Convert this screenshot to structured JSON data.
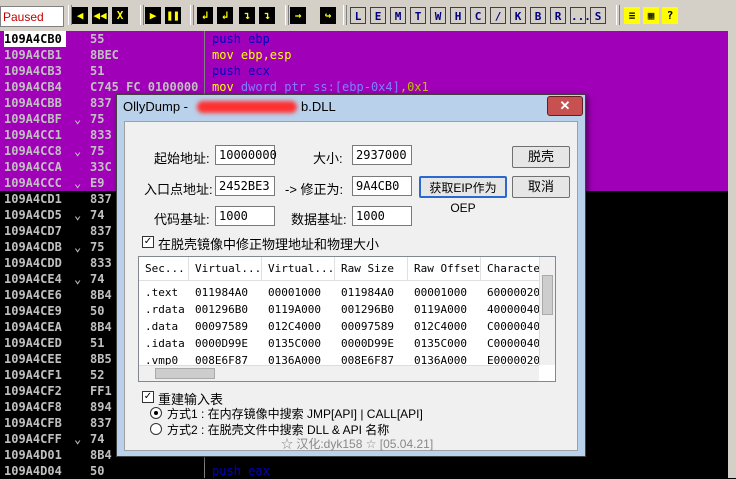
{
  "toolbar": {
    "status": "Paused",
    "buttons": [
      "◀",
      "◀◀",
      "X",
      "▶",
      "❚❚",
      "↲",
      "↲",
      "↴",
      "↴",
      "→",
      "↪"
    ],
    "letters": [
      "L",
      "E",
      "M",
      "T",
      "W",
      "H",
      "C",
      "/",
      "K",
      "B",
      "R",
      "...",
      "S"
    ]
  },
  "disassembly": {
    "rows": [
      {
        "addr": "109A4CB0",
        "hex": "55",
        "arrow": "",
        "asm": [
          {
            "t": "push ",
            "c": "kw"
          },
          {
            "t": "ebp",
            "c": "kw"
          }
        ]
      },
      {
        "addr": "109A4CB1",
        "hex": "8BEC",
        "arrow": "",
        "asm": [
          {
            "t": "mov ",
            "c": "mv"
          },
          {
            "t": "ebp,esp",
            "c": "mv"
          }
        ]
      },
      {
        "addr": "109A4CB3",
        "hex": "51",
        "arrow": "",
        "asm": [
          {
            "t": "push ",
            "c": "kw"
          },
          {
            "t": "ecx",
            "c": "kw"
          }
        ]
      },
      {
        "addr": "109A4CB4",
        "hex": "C745 FC 0100000",
        "arrow": "",
        "asm": [
          {
            "t": "mov ",
            "c": "mv"
          },
          {
            "t": "dword ptr ss:[ebp-0x4]",
            "c": "mem"
          },
          {
            "t": ",0x1",
            "c": "num"
          }
        ]
      },
      {
        "addr": "109A4CBB",
        "hex": "837",
        "arrow": "",
        "asm": []
      },
      {
        "addr": "109A4CBF",
        "hex": "75",
        "arrow": "⌄",
        "asm": []
      },
      {
        "addr": "109A4CC1",
        "hex": "833",
        "arrow": "",
        "asm": []
      },
      {
        "addr": "109A4CC8",
        "hex": "75",
        "arrow": "⌄",
        "asm": []
      },
      {
        "addr": "109A4CCA",
        "hex": "33C",
        "arrow": "",
        "asm": []
      },
      {
        "addr": "109A4CCC",
        "hex": "E9",
        "arrow": "⌄",
        "asm": []
      },
      {
        "addr": "109A4CD1",
        "hex": "837",
        "arrow": "",
        "asm": []
      },
      {
        "addr": "109A4CD5",
        "hex": "74",
        "arrow": "⌄",
        "asm": []
      },
      {
        "addr": "109A4CD7",
        "hex": "837",
        "arrow": "",
        "asm": []
      },
      {
        "addr": "109A4CDB",
        "hex": "75",
        "arrow": "⌄",
        "asm": []
      },
      {
        "addr": "109A4CDD",
        "hex": "833",
        "arrow": "",
        "asm": []
      },
      {
        "addr": "109A4CE4",
        "hex": "74",
        "arrow": "⌄",
        "asm": []
      },
      {
        "addr": "109A4CE6",
        "hex": "8B4",
        "arrow": "",
        "asm": []
      },
      {
        "addr": "109A4CE9",
        "hex": "50",
        "arrow": "",
        "asm": []
      },
      {
        "addr": "109A4CEA",
        "hex": "8B4",
        "arrow": "",
        "asm": []
      },
      {
        "addr": "109A4CED",
        "hex": "51",
        "arrow": "",
        "asm": []
      },
      {
        "addr": "109A4CEE",
        "hex": "8B5",
        "arrow": "",
        "asm": []
      },
      {
        "addr": "109A4CF1",
        "hex": "52",
        "arrow": "",
        "asm": []
      },
      {
        "addr": "109A4CF2",
        "hex": "FF1",
        "arrow": "",
        "asm": []
      },
      {
        "addr": "109A4CF8",
        "hex": "894",
        "arrow": "",
        "asm": []
      },
      {
        "addr": "109A4CFB",
        "hex": "837",
        "arrow": "",
        "asm": []
      },
      {
        "addr": "109A4CFF",
        "hex": "74",
        "arrow": "⌄",
        "asm": []
      },
      {
        "addr": "109A4D01",
        "hex": "8B4",
        "arrow": "",
        "asm": []
      },
      {
        "addr": "109A4D04",
        "hex": "50",
        "arrow": "",
        "asm": [
          {
            "t": "push ",
            "c": "kw"
          },
          {
            "t": "eax",
            "c": "kw"
          }
        ]
      }
    ]
  },
  "dialog": {
    "title": "OllyDump - ",
    "title_suffix": "b.DLL",
    "close": "✕",
    "start_addr_label": "起始地址:",
    "start_addr": "10000000",
    "size_label": "大小:",
    "size": "2937000",
    "unpack_btn": "脱壳",
    "ep_label": "入口点地址:",
    "ep": "2452BE3",
    "fix_label": "-> 修正为:",
    "fix": "9A4CB0",
    "get_eip_btn": "获取EIP作为OEP",
    "cancel_btn": "取消",
    "code_base_label": "代码基址:",
    "code_base": "1000",
    "data_base_label": "数据基址:",
    "data_base": "1000",
    "fix_raw_label": "在脱壳镜像中修正物理地址和物理大小",
    "fix_raw_checked": "✓",
    "table": {
      "headers": [
        "Sec...",
        "Virtual...",
        "Virtual...",
        "Raw Size",
        "Raw Offset",
        "Characteris"
      ],
      "rows": [
        [
          ".text",
          "011984A0",
          "00001000",
          "011984A0",
          "00001000",
          "60000020"
        ],
        [
          ".rdata",
          "001296B0",
          "0119A000",
          "001296B0",
          "0119A000",
          "40000040"
        ],
        [
          ".data",
          "00097589",
          "012C4000",
          "00097589",
          "012C4000",
          "C0000040"
        ],
        [
          ".idata",
          "0000D99E",
          "0135C000",
          "0000D99E",
          "0135C000",
          "C0000040"
        ],
        [
          ".vmp0",
          "008E6F87",
          "0136A000",
          "008E6F87",
          "0136A000",
          "E0000020"
        ]
      ]
    },
    "rebuild_label": "重建输入表",
    "rebuild_checked": "✓",
    "method1": "方式1 : 在内存镜像中搜索 JMP[API] | CALL[API]",
    "method2": "方式2 : 在脱壳文件中搜索 DLL & API 名称",
    "credit": "☆ 汉化:dyk158 ☆ [05.04.21]"
  },
  "colors": {
    "highlight": "#a000b8",
    "dialog_frame": "#b9d1ea",
    "close_button": "#c75050"
  }
}
